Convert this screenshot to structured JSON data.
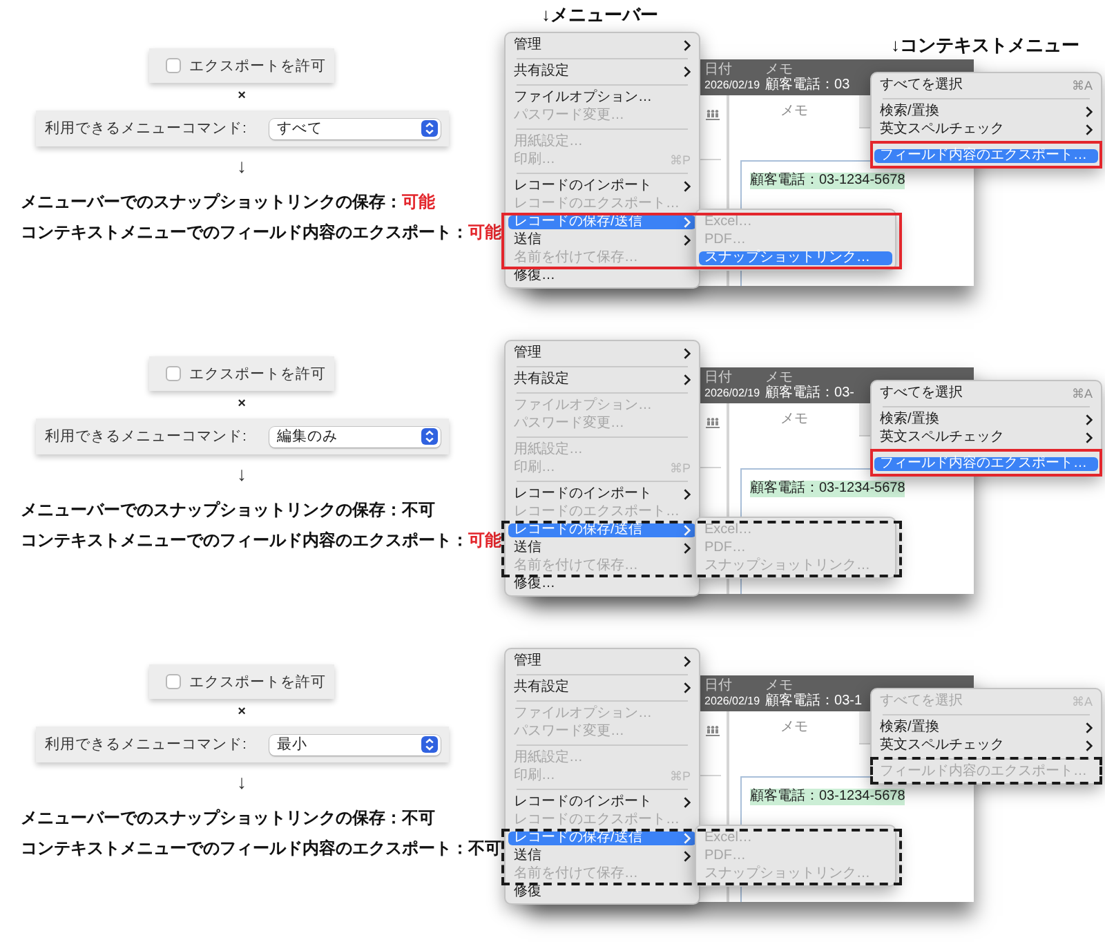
{
  "annotations": {
    "menu_bar": "↓メニューバー",
    "context_menu": "↓コンテキストメニュー"
  },
  "cases": [
    {
      "settings": {
        "export_checkbox": {
          "label": "エクスポートを許可",
          "checked": false
        },
        "operator": "×",
        "menu_commands": {
          "label": "利用できるメニューコマンド:",
          "value": "すべて"
        },
        "arrow": "↓"
      },
      "results": [
        {
          "label": "メニューバーでのスナップショットリンクの保存：",
          "value": "可能",
          "allowed": true
        },
        {
          "label": "コンテキストメニューでのフィールド内容のエクスポート：",
          "value": "可能",
          "allowed": true
        }
      ],
      "app_window": {
        "header_fields": [
          {
            "label": "日付",
            "value": "2026/02/19"
          },
          {
            "label": "メモ",
            "value": "顧客電話：03"
          }
        ],
        "tab": "メモ",
        "field_text": "顧客電話：03-1234-5678"
      },
      "menubar_menu": {
        "highlight_available": true,
        "sections": [
          [
            {
              "label": "管理",
              "submenu": true,
              "disabled": false,
              "selected": false
            }
          ],
          [
            {
              "label": "共有設定",
              "submenu": true,
              "disabled": false,
              "selected": false
            }
          ],
          [
            {
              "label": "ファイルオプション…",
              "submenu": false,
              "disabled": false,
              "selected": false
            },
            {
              "label": "パスワード変更…",
              "submenu": false,
              "disabled": true,
              "selected": false
            }
          ],
          [
            {
              "label": "用紙設定…",
              "submenu": false,
              "disabled": true,
              "selected": false
            },
            {
              "label": "印刷…",
              "shortcut": "⌘P",
              "submenu": false,
              "disabled": true,
              "selected": false
            }
          ],
          [
            {
              "label": "レコードのインポート",
              "submenu": true,
              "disabled": false,
              "selected": false
            },
            {
              "label": "レコードのエクスポート…",
              "submenu": false,
              "disabled": true,
              "selected": false
            },
            {
              "label": "レコードの保存/送信",
              "submenu": true,
              "disabled": false,
              "selected": true
            },
            {
              "label": "送信",
              "submenu": true,
              "disabled": false,
              "selected": false
            },
            {
              "label": "名前を付けて保存…",
              "submenu": false,
              "disabled": true,
              "selected": false
            },
            {
              "label": "修復…",
              "submenu": false,
              "disabled": false,
              "selected": false
            }
          ]
        ],
        "submenu": [
          {
            "label": "Excel…",
            "disabled": true,
            "selected": false
          },
          {
            "label": "PDF…",
            "disabled": true,
            "selected": false
          },
          {
            "label": "スナップショットリンク…",
            "disabled": false,
            "selected": true
          }
        ]
      },
      "context_menu": {
        "highlight_available": true,
        "sections": [
          [
            {
              "label": "すべてを選択",
              "shortcut": "⌘A",
              "submenu": false,
              "disabled": false,
              "selected": false
            }
          ],
          [
            {
              "label": "検索/置換",
              "submenu": true,
              "disabled": false,
              "selected": false
            },
            {
              "label": "英文スペルチェック",
              "submenu": true,
              "disabled": false,
              "selected": false
            }
          ],
          [
            {
              "label": "フィールド内容のエクスポート…",
              "submenu": false,
              "disabled": false,
              "selected": true
            }
          ]
        ]
      }
    },
    {
      "settings": {
        "export_checkbox": {
          "label": "エクスポートを許可",
          "checked": false
        },
        "operator": "×",
        "menu_commands": {
          "label": "利用できるメニューコマンド:",
          "value": "編集のみ"
        },
        "arrow": "↓"
      },
      "results": [
        {
          "label": "メニューバーでのスナップショットリンクの保存：",
          "value": "不可",
          "allowed": false
        },
        {
          "label": "コンテキストメニューでのフィールド内容のエクスポート：",
          "value": "可能",
          "allowed": true
        }
      ],
      "app_window": {
        "header_fields": [
          {
            "label": "日付",
            "value": "2026/02/19"
          },
          {
            "label": "メモ",
            "value": "顧客電話：03-"
          }
        ],
        "tab": "メモ",
        "field_text": "顧客電話：03-1234-5678"
      },
      "menubar_menu": {
        "highlight_available": false,
        "sections": [
          [
            {
              "label": "管理",
              "submenu": true,
              "disabled": false,
              "selected": false
            }
          ],
          [
            {
              "label": "共有設定",
              "submenu": true,
              "disabled": false,
              "selected": false
            }
          ],
          [
            {
              "label": "ファイルオプション…",
              "submenu": false,
              "disabled": true,
              "selected": false
            },
            {
              "label": "パスワード変更…",
              "submenu": false,
              "disabled": true,
              "selected": false
            }
          ],
          [
            {
              "label": "用紙設定…",
              "submenu": false,
              "disabled": true,
              "selected": false
            },
            {
              "label": "印刷…",
              "shortcut": "⌘P",
              "submenu": false,
              "disabled": true,
              "selected": false
            }
          ],
          [
            {
              "label": "レコードのインポート",
              "submenu": true,
              "disabled": false,
              "selected": false
            },
            {
              "label": "レコードのエクスポート…",
              "submenu": false,
              "disabled": true,
              "selected": false
            },
            {
              "label": "レコードの保存/送信",
              "submenu": true,
              "disabled": false,
              "selected": true
            },
            {
              "label": "送信",
              "submenu": true,
              "disabled": false,
              "selected": false
            },
            {
              "label": "名前を付けて保存…",
              "submenu": false,
              "disabled": true,
              "selected": false
            },
            {
              "label": "修復…",
              "submenu": false,
              "disabled": false,
              "selected": false
            }
          ]
        ],
        "submenu": [
          {
            "label": "Excel…",
            "disabled": true,
            "selected": false
          },
          {
            "label": "PDF…",
            "disabled": true,
            "selected": false
          },
          {
            "label": "スナップショットリンク…",
            "disabled": true,
            "selected": false
          }
        ]
      },
      "context_menu": {
        "highlight_available": true,
        "sections": [
          [
            {
              "label": "すべてを選択",
              "shortcut": "⌘A",
              "submenu": false,
              "disabled": false,
              "selected": false
            }
          ],
          [
            {
              "label": "検索/置換",
              "submenu": true,
              "disabled": false,
              "selected": false
            },
            {
              "label": "英文スペルチェック",
              "submenu": true,
              "disabled": false,
              "selected": false
            }
          ],
          [
            {
              "label": "フィールド内容のエクスポート…",
              "submenu": false,
              "disabled": false,
              "selected": true
            }
          ]
        ]
      }
    },
    {
      "settings": {
        "export_checkbox": {
          "label": "エクスポートを許可",
          "checked": false
        },
        "operator": "×",
        "menu_commands": {
          "label": "利用できるメニューコマンド:",
          "value": "最小"
        },
        "arrow": "↓"
      },
      "results": [
        {
          "label": "メニューバーでのスナップショットリンクの保存：",
          "value": "不可",
          "allowed": false
        },
        {
          "label": "コンテキストメニューでのフィールド内容のエクスポート：",
          "value": "不可",
          "allowed": false
        }
      ],
      "app_window": {
        "header_fields": [
          {
            "label": "日付",
            "value": "2026/02/19"
          },
          {
            "label": "メモ",
            "value": "顧客電話：03-1"
          }
        ],
        "tab": "メモ",
        "field_text": "顧客電話：03-1234-5678"
      },
      "menubar_menu": {
        "highlight_available": false,
        "sections": [
          [
            {
              "label": "管理",
              "submenu": true,
              "disabled": false,
              "selected": false
            }
          ],
          [
            {
              "label": "共有設定",
              "submenu": true,
              "disabled": false,
              "selected": false
            }
          ],
          [
            {
              "label": "ファイルオプション…",
              "submenu": false,
              "disabled": true,
              "selected": false
            },
            {
              "label": "パスワード変更…",
              "submenu": false,
              "disabled": true,
              "selected": false
            }
          ],
          [
            {
              "label": "用紙設定…",
              "submenu": false,
              "disabled": true,
              "selected": false
            },
            {
              "label": "印刷…",
              "shortcut": "⌘P",
              "submenu": false,
              "disabled": true,
              "selected": false
            }
          ],
          [
            {
              "label": "レコードのインポート",
              "submenu": true,
              "disabled": false,
              "selected": false
            },
            {
              "label": "レコードのエクスポート…",
              "submenu": false,
              "disabled": true,
              "selected": false
            },
            {
              "label": "レコードの保存/送信",
              "submenu": true,
              "disabled": false,
              "selected": true
            },
            {
              "label": "送信",
              "submenu": true,
              "disabled": false,
              "selected": false
            },
            {
              "label": "名前を付けて保存…",
              "submenu": false,
              "disabled": true,
              "selected": false
            },
            {
              "label": "修復",
              "submenu": false,
              "disabled": false,
              "selected": false
            }
          ]
        ],
        "submenu": [
          {
            "label": "Excel…",
            "disabled": true,
            "selected": false
          },
          {
            "label": "PDF…",
            "disabled": true,
            "selected": false
          },
          {
            "label": "スナップショットリンク…",
            "disabled": true,
            "selected": false
          }
        ]
      },
      "context_menu": {
        "highlight_available": false,
        "sections": [
          [
            {
              "label": "すべてを選択",
              "shortcut": "⌘A",
              "submenu": false,
              "disabled": true,
              "selected": false
            }
          ],
          [
            {
              "label": "検索/置換",
              "submenu": true,
              "disabled": false,
              "selected": false
            },
            {
              "label": "英文スペルチェック",
              "submenu": true,
              "disabled": false,
              "selected": false
            }
          ],
          [
            {
              "label": "フィールド内容のエクスポート…",
              "submenu": false,
              "disabled": true,
              "selected": false
            }
          ]
        ]
      }
    }
  ]
}
